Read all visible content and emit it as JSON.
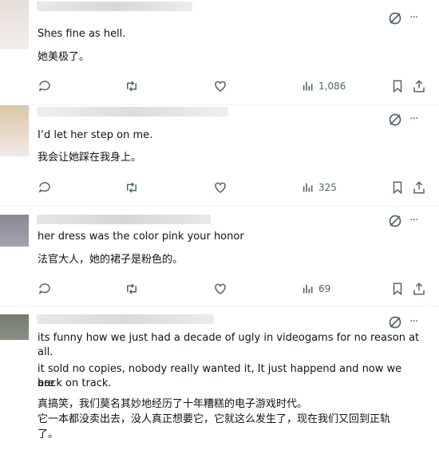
{
  "colors": {
    "text": "#0f1419",
    "muted": "#536471",
    "separator": "#eff3f4"
  },
  "icons": {
    "grok": "grok-icon",
    "more": "more-icon",
    "reply": "reply-icon",
    "retweet": "retweet-icon",
    "like": "like-icon",
    "views": "views-icon",
    "bookmark": "bookmark-icon",
    "share": "share-icon"
  },
  "more_glyph": "···",
  "replies": [
    {
      "lines": [
        "Shes fine as hell."
      ],
      "translation": [
        "她美极了。"
      ],
      "views": "1,086"
    },
    {
      "lines": [
        "I’d let her step on me."
      ],
      "translation": [
        "我会让她踩在我身上。"
      ],
      "views": "325"
    },
    {
      "lines": [
        "her dress was the color pink your honor"
      ],
      "translation": [
        "法官大人，她的裙子是粉色的。"
      ],
      "views": "69"
    },
    {
      "lines": [
        "its funny how we just had a decade of ugly in videogams for no reason at",
        "all.",
        "it sold no copies, nobody really wanted it, It just happend and now we are",
        "back on track."
      ],
      "translation": [
        "真搞笑，我们莫名其妙地经历了十年糟糕的电子游戏时代。",
        "它一本都没卖出去，没人真正想要它，它就这么发生了，现在我们又回到正轨",
        "了。"
      ]
    }
  ]
}
